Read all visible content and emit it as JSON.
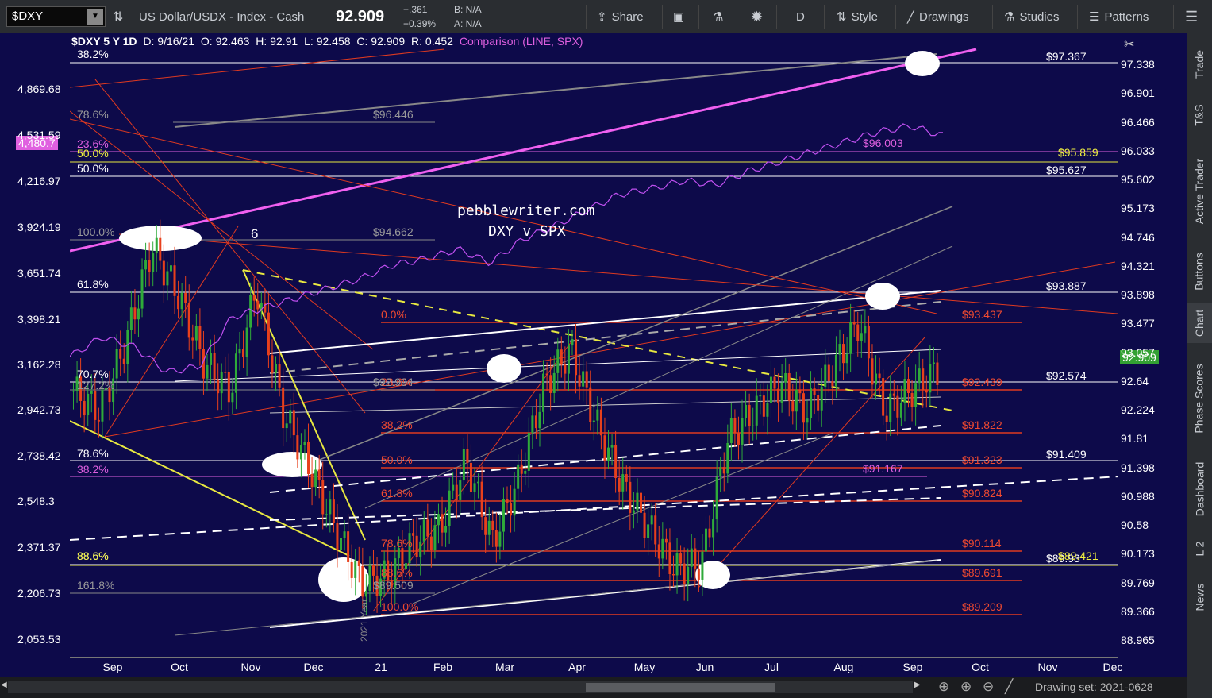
{
  "toolbar": {
    "symbol": "$DXY",
    "description": "US Dollar/USDX - Index - Cash",
    "last": "92.909",
    "change": "+.361",
    "change_pct": "+0.39%",
    "bid": "B: N/A",
    "ask": "A: N/A",
    "share": "Share",
    "period": "D",
    "style": "Style",
    "drawings": "Drawings",
    "studies": "Studies",
    "patterns": "Patterns"
  },
  "header": {
    "title": "$DXY 5 Y 1D",
    "date": "D: 9/16/21",
    "open": "O: 92.463",
    "high": "H: 92.91",
    "low": "L: 92.458",
    "close": "C: 92.909",
    "range": "R: 0.452",
    "comparison": "Comparison (LINE, SPX)"
  },
  "left_axis": [
    "4,869.68",
    "4,531.59",
    "4,216.97",
    "3,924.19",
    "3,651.74",
    "3,398.21",
    "3,162.28",
    "2,942.73",
    "2,738.42",
    "2,548.3",
    "2,371.37",
    "2,206.73",
    "2,053.53"
  ],
  "left_badge": "4,480.7",
  "right_axis": [
    "97.338",
    "96.901",
    "96.466",
    "96.033",
    "95.602",
    "95.173",
    "94.746",
    "94.321",
    "93.898",
    "93.477",
    "93.057",
    "92.64",
    "92.224",
    "91.81",
    "91.398",
    "90.988",
    "90.58",
    "90.173",
    "89.769",
    "89.366",
    "88.965"
  ],
  "right_badge": "92.909",
  "x_axis": [
    "Sep",
    "Oct",
    "Nov",
    "Dec",
    "21",
    "Feb",
    "Mar",
    "Apr",
    "May",
    "Jun",
    "Jul",
    "Aug",
    "Sep",
    "Oct",
    "Nov",
    "Dec"
  ],
  "annotations": {
    "title": "pebblewriter.com",
    "subtitle": "DXY v SPX",
    "wave_label": "6",
    "year_label": "2021 Year",
    "spx_high": "$96.003",
    "spx_fib": "$91.167"
  },
  "white_levels": [
    "$97.367",
    "$95.627",
    "$93.887",
    "$92.574",
    "$91.409",
    "$89.93"
  ],
  "yellow_levels": [
    "$95.859",
    "$89.421"
  ],
  "red_levels": [
    "$93.437",
    "$92.439",
    "$91.822",
    "$91.323",
    "$90.824",
    "$90.114",
    "$89.691",
    "$89.209"
  ],
  "fib_left": [
    "38.2%",
    "78.6%",
    "23.6%",
    "50.0%",
    "50.0%",
    "100.0%",
    "61.8%",
    "70.7%",
    "127.2%",
    "78.6%",
    "38.2%",
    "88.6%",
    "88.6%",
    "161.8%"
  ],
  "fib_red": [
    "0.0%",
    "23.6%",
    "38.2%",
    "50.0%",
    "61.8%",
    "78.6%",
    "88.6%",
    "100.0%"
  ],
  "fib_gray": [
    "$96.446",
    "$94.662",
    "$92.994",
    "$89.509"
  ],
  "right_panel": [
    "Trade",
    "T&S",
    "Active Trader",
    "Buttons",
    "Chart",
    "Phase Scores",
    "Dashboard",
    "L 2",
    "News"
  ],
  "footer": {
    "drawing_set": "Drawing set: 2021-0628"
  },
  "chart_data": {
    "type": "line",
    "title": "pebblewriter.com DXY v SPX",
    "series": [
      {
        "name": "$DXY",
        "values": [
          92.6,
          92.3,
          93.3,
          94.7,
          94.0,
          93.0,
          92.6,
          94.1,
          92.3,
          91.5,
          90.6,
          89.8,
          89.9,
          90.4,
          90.6,
          91.6,
          90.4,
          91.3,
          92.7,
          93.2,
          92.1,
          91.2,
          90.6,
          90.0,
          90.1,
          91.9,
          92.3,
          92.7,
          92.3,
          92.9,
          93.6,
          92.3,
          92.6,
          92.9
        ]
      },
      {
        "name": "SPX",
        "values": [
          3350,
          3450,
          3400,
          3270,
          3300,
          3550,
          3600,
          3650,
          3700,
          3750,
          3820,
          3850,
          3900,
          3830,
          3950,
          4020,
          4100,
          4180,
          4210,
          4250,
          4230,
          4300,
          4350,
          4400,
          4450,
          4500,
          4530,
          4480
        ]
      }
    ]
  }
}
